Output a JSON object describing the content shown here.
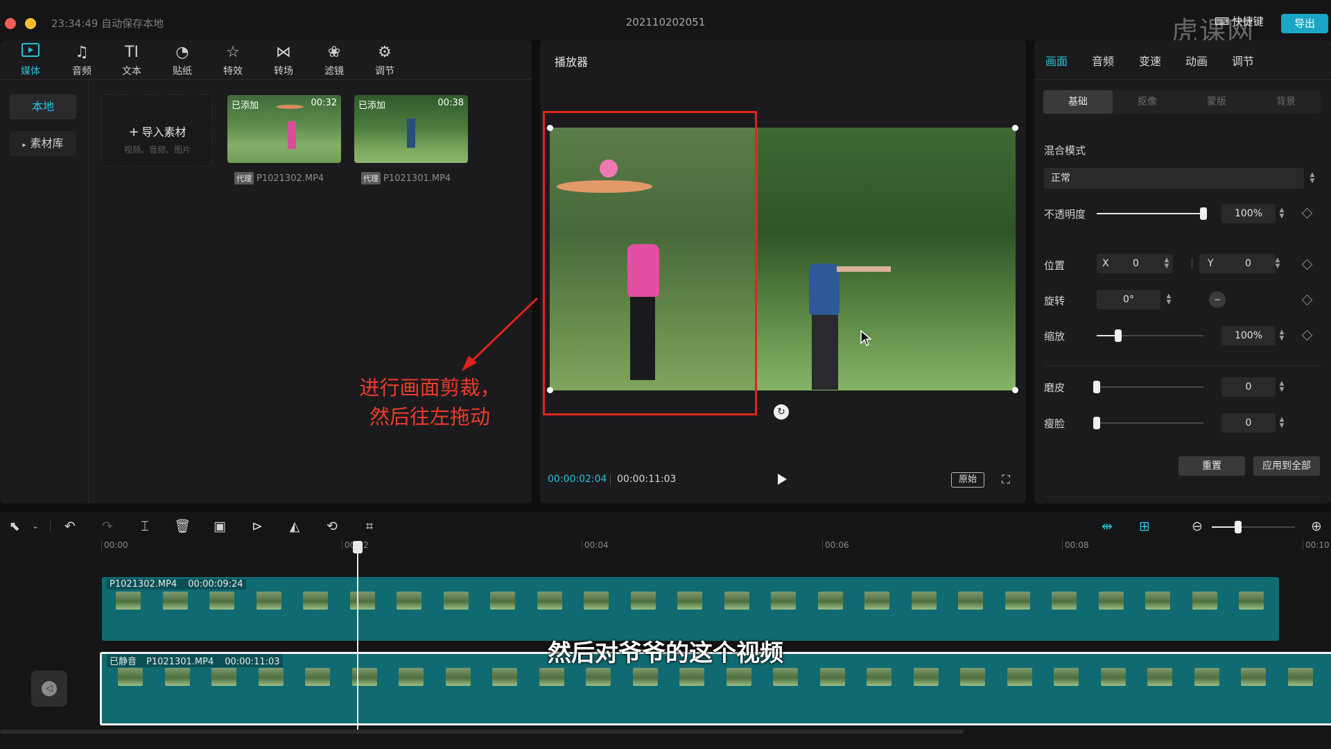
{
  "titlebar": {
    "autosave": "23:34:49 自动保存本地",
    "project": "202110202051",
    "shortcut": "快捷键",
    "export": "导出",
    "watermark": "虎课网"
  },
  "media_toolbar": [
    {
      "label": "媒体",
      "icon": "media-icon"
    },
    {
      "label": "音频",
      "icon": "audio-icon"
    },
    {
      "label": "文本",
      "icon": "text-icon"
    },
    {
      "label": "贴纸",
      "icon": "sticker-icon"
    },
    {
      "label": "特效",
      "icon": "effects-icon"
    },
    {
      "label": "转场",
      "icon": "transition-icon"
    },
    {
      "label": "滤镜",
      "icon": "filter-icon"
    },
    {
      "label": "调节",
      "icon": "adjust-icon"
    }
  ],
  "sidebar": {
    "local": "本地",
    "library": "素材库"
  },
  "import": {
    "label": "导入素材",
    "hint": "视频、音频、图片"
  },
  "media_items": [
    {
      "tag": "已添加",
      "duration": "00:32",
      "badge": "代理",
      "name": "P1021302.MP4"
    },
    {
      "tag": "已添加",
      "duration": "00:38",
      "badge": "代理",
      "name": "P1021301.MP4"
    }
  ],
  "player": {
    "title": "播放器",
    "current_time": "00:00:02:04",
    "total_time": "00:00:11:03",
    "ratio": "原始"
  },
  "annotation": {
    "line1": "进行画面剪裁，",
    "line2": "然后往左拖动"
  },
  "subtitle": "然后对爷爷的这个视频",
  "props": {
    "tabs": [
      "画面",
      "音频",
      "变速",
      "动画",
      "调节"
    ],
    "subtabs": [
      "基础",
      "抠像",
      "蒙版",
      "背景"
    ],
    "blend_label": "混合模式",
    "blend_value": "正常",
    "opacity_label": "不透明度",
    "opacity_value": "100%",
    "opacity_level": 1.0,
    "position_label": "位置",
    "x_label": "X",
    "x_value": "0",
    "y_label": "Y",
    "y_value": "0",
    "rotate_label": "旋转",
    "rotate_value": "0°",
    "scale_label": "缩放",
    "scale_value": "100%",
    "scale_level": 0.2,
    "smooth_label": "磨皮",
    "smooth_value": "0",
    "slim_label": "瘦脸",
    "slim_value": "0",
    "reset": "重置",
    "apply_all": "应用到全部"
  },
  "timeline": {
    "ticks": [
      "00:00",
      "00:02",
      "00:04",
      "00:06",
      "00:08",
      "00:10"
    ],
    "track1": {
      "name": "P1021302.MP4",
      "duration": "00:00:09:24"
    },
    "track2": {
      "muted": "已静音",
      "name": "P1021301.MP4",
      "duration": "00:00:11:03"
    }
  }
}
